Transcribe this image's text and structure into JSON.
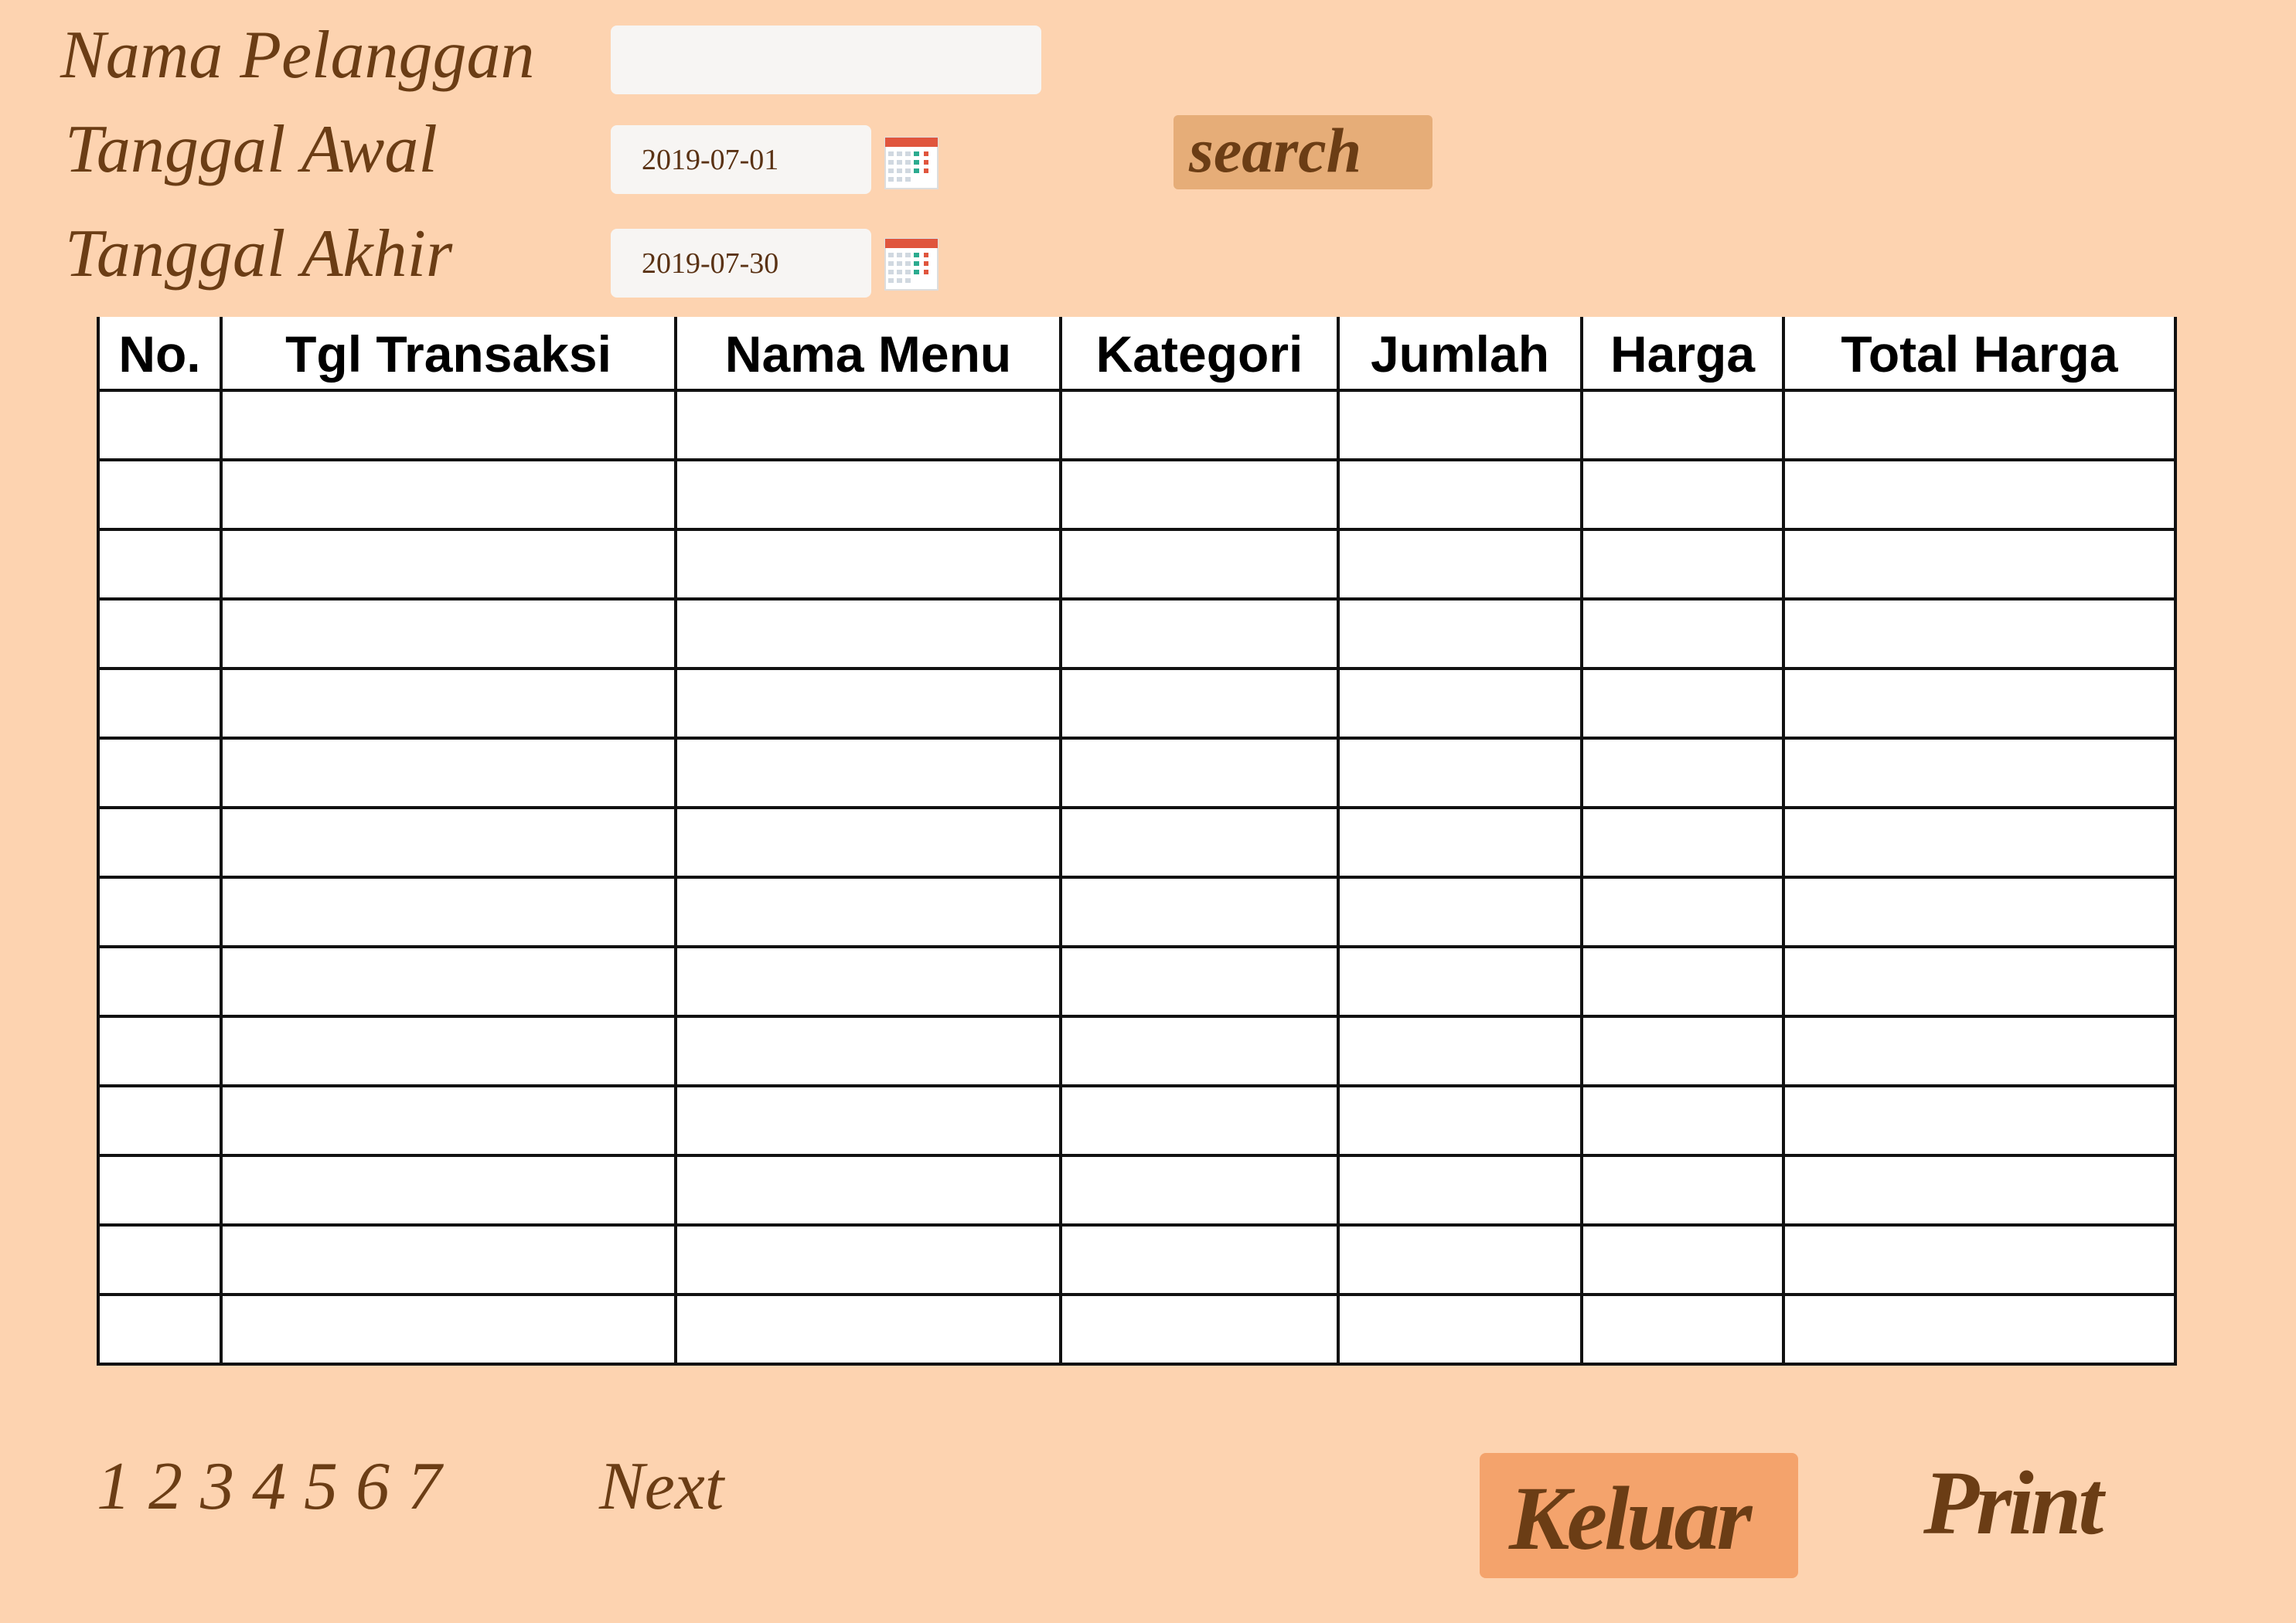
{
  "form": {
    "customer_label": "Nama Pelanggan",
    "customer_value": "",
    "start_date_label": "Tanggal Awal",
    "start_date_value": "2019-07-01",
    "end_date_label": "Tanggal Akhir",
    "end_date_value": "2019-07-30",
    "search_label": "search"
  },
  "table": {
    "columns": [
      "No.",
      "Tgl Transaksi",
      "Nama Menu",
      "Kategori",
      "Jumlah",
      "Harga",
      "Total Harga"
    ],
    "empty_row_count": 14
  },
  "pagination": {
    "pages": [
      "1",
      "2",
      "3",
      "4",
      "5",
      "6",
      "7"
    ],
    "next_label": "Next"
  },
  "actions": {
    "exit_label": "Keluar",
    "print_label": "Print"
  },
  "colors": {
    "background": "#fdd3b0",
    "text": "#6b3d15",
    "search_button": "#e6ad78",
    "exit_button": "#f4a36c"
  },
  "icons": {
    "start_date_picker": "calendar-icon",
    "end_date_picker": "calendar-icon"
  }
}
